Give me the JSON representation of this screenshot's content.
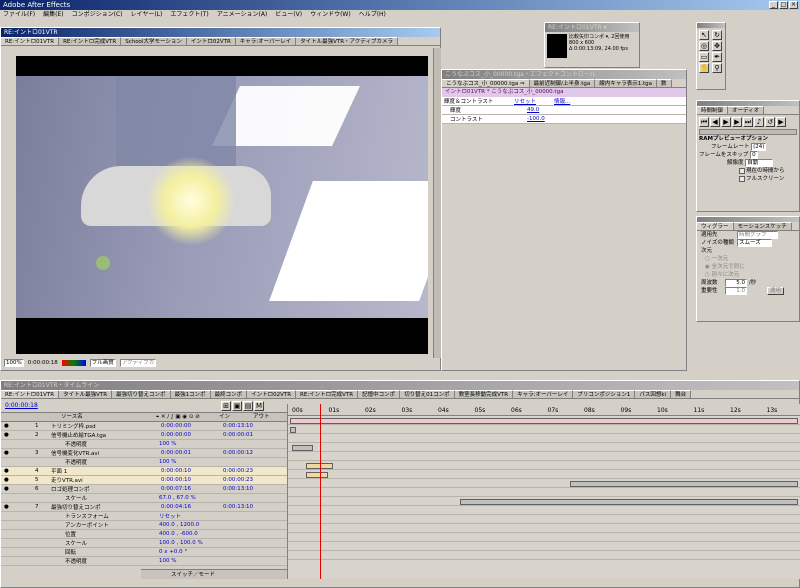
{
  "app": {
    "title": "Adobe After Effects"
  },
  "menu": [
    "ファイル(F)",
    "編集(E)",
    "コンポジション(C)",
    "レイヤー(L)",
    "エフェクト(T)",
    "アニメーション(A)",
    "ビュー(V)",
    "ウィンドウ(W)",
    "ヘルプ(H)"
  ],
  "comp_window": {
    "title": "RE:イントロ01VTR",
    "tabs": [
      "RE:イントロ01VTR",
      "RE:イントロ完成VTR",
      "School大学モーション",
      "イントロ02VTR",
      "キャラ:オーバーレイ",
      "タイトル最強VTR・アクティブカメラ"
    ],
    "footer": {
      "zoom": "100%",
      "time": "0:00:00:18",
      "resolution": "フル画質",
      "view": "アクティブカ"
    }
  },
  "project_panel": {
    "title": "RE:イントロ01VTR ▾",
    "info_line1": "比較矢印コンポ ▾, 2回使用",
    "info_line2": "800 x 600",
    "info_line3": "Δ 0:00:13:09, 24.00 fps"
  },
  "effect_controls": {
    "title": "こうなぶコス_小_00000.tga・エフェクトコントロール",
    "tabs": [
      "こうなぶコス_小_00000.tga ⇒",
      "最前近制御/上半身.tga",
      "線内キャラ表示1.tga",
      "数"
    ],
    "breadcrumb": "イントロ01VTR * こうなぶコス_小_00000.tga",
    "effect_name": "輝度＆コントラスト",
    "reset_label": "リセット",
    "info_label": "情報...",
    "params": [
      {
        "name": "輝度",
        "value": "49.0"
      },
      {
        "name": "コントラスト",
        "value": "-100.0"
      }
    ]
  },
  "time_controls": {
    "tabs": [
      "時間制御",
      "オーディオ"
    ],
    "ram_title": "RAMプレビューオプション",
    "framerate_label": "フレームレート",
    "framerate_value": "(24)",
    "skip_label": "フレームをスキップ",
    "skip_value": "0",
    "res_label": "解像度",
    "res_value": "自動",
    "from_current": "現在の時間から",
    "fullscreen": "フルスクリーン"
  },
  "wiggler": {
    "tabs": [
      "ウィグラー",
      "モーションスケッチ"
    ],
    "apply_label": "適用先",
    "apply_value": "時間グラフ",
    "noise_label": "ノイズの種類",
    "noise_value": "スムーズ",
    "dim_label": "次元",
    "dim_opts": [
      "一次元",
      "全次元で同じ",
      "別々に次元"
    ],
    "freq_label": "周波数",
    "freq_value": "5.0",
    "freq_unit": "/秒",
    "mag_label": "重要性",
    "mag_value": "1.0",
    "apply_btn": "適用"
  },
  "timeline": {
    "title": "RE:イントロ01VTR・タイムライン",
    "tabs": [
      "RE:イントロ01VTR",
      "タイトル最強VTR",
      "最強切り替えコンポ",
      "最強1コンポ",
      "最終コンポ",
      "イントロ02VTR",
      "RE:イントロ完成VTR",
      "記憶中コンポ",
      "切り替え01コンポ",
      "教室長移動完成VTR",
      "キャラ:オーバーレイ",
      "プリコンポジション1",
      "パス回想ki",
      "舞台"
    ],
    "current_time": "0:00:00:18",
    "col_source": "ソース名",
    "col_in": "イン",
    "col_out": "アウト",
    "ruler": [
      "00s",
      "01s",
      "02s",
      "03s",
      "04s",
      "05s",
      "06s",
      "07s",
      "08s",
      "09s",
      "10s",
      "11s",
      "12s",
      "13s"
    ],
    "footer_label": "スイッチ／モード",
    "layers": [
      {
        "num": "1",
        "name": "トリミング枠.psd",
        "in": "0:00:00:00",
        "out": "0:00:13:10",
        "sub": false
      },
      {
        "num": "2",
        "name": "信号機止め絵TGA.tga",
        "in": "0:00:00:00",
        "out": "0:00:00:01",
        "sub": false
      },
      {
        "num": "",
        "name": "不透明度",
        "in": "100 %",
        "out": "",
        "sub": true
      },
      {
        "num": "3",
        "name": "信号機変化VTR.avi",
        "in": "0:00:00:01",
        "out": "0:00:00:12",
        "sub": false
      },
      {
        "num": "",
        "name": "不透明度",
        "in": "100 %",
        "out": "",
        "sub": true
      },
      {
        "num": "4",
        "name": "平面 1",
        "in": "0:00:00:10",
        "out": "0:00:00:23",
        "sub": false
      },
      {
        "num": "5",
        "name": "走りVTR.avi",
        "in": "0:00:00:10",
        "out": "0:00:00:23",
        "sub": false
      },
      {
        "num": "6",
        "name": "ロゴ処理コンポ",
        "in": "0:00:07:16",
        "out": "0:00:13:10",
        "sub": false
      },
      {
        "num": "",
        "name": "スケール",
        "in": "67.0 , 67.0 %",
        "out": "",
        "sub": true
      },
      {
        "num": "7",
        "name": "最強切り替えコンポ",
        "in": "0:00:04:16",
        "out": "0:00:13:10",
        "sub": false
      },
      {
        "num": "",
        "name": "トランスフォーム",
        "in": "リセット",
        "out": "",
        "sub": true
      },
      {
        "num": "",
        "name": "アンカーポイント",
        "in": "400.0 , 1200.0",
        "out": "",
        "sub": true
      },
      {
        "num": "",
        "name": "位置",
        "in": "400.0 , -600.0",
        "out": "",
        "sub": true
      },
      {
        "num": "",
        "name": "スケール",
        "in": "100.0 , 100.0 %",
        "out": "",
        "sub": true
      },
      {
        "num": "",
        "name": "回転",
        "in": "0 x +0.0 °",
        "out": "",
        "sub": true
      },
      {
        "num": "",
        "name": "不透明度",
        "in": "100 %",
        "out": "",
        "sub": true
      }
    ]
  }
}
